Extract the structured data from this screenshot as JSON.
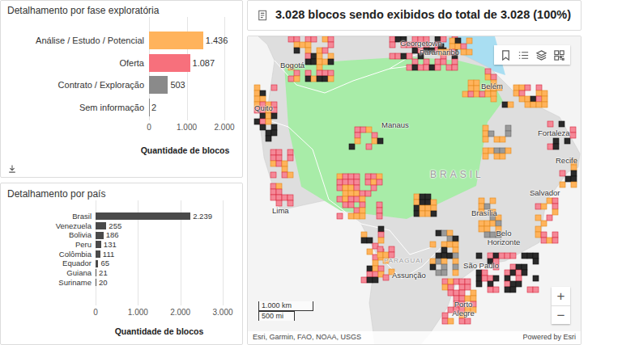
{
  "phase_chart": {
    "title": "Detalhamento por fase exploratória",
    "bars": [
      {
        "label": "Análise / Estudo / Potencial",
        "value": 1436,
        "value_label": "1.436",
        "color": "#ffb35c"
      },
      {
        "label": "Oferta",
        "value": 1087,
        "value_label": "1.087",
        "color": "#f7707c"
      },
      {
        "label": "Contrato / Exploração",
        "value": 503,
        "value_label": "503",
        "color": "#8a8a8a"
      },
      {
        "label": "Sem informação",
        "value": 2,
        "value_label": "2",
        "color": "#8a8a8a"
      }
    ],
    "ticks": [
      "0",
      "1.000",
      "2.000"
    ],
    "axis_max": 2000,
    "axis_title": "Quantidade de blocos"
  },
  "country_chart": {
    "title": "Detalhamento por país",
    "bars": [
      {
        "label": "Brasil",
        "value": 2239,
        "value_label": "2.239"
      },
      {
        "label": "Venezuela",
        "value": 255,
        "value_label": "255"
      },
      {
        "label": "Bolivia",
        "value": 186,
        "value_label": "186"
      },
      {
        "label": "Peru",
        "value": 131,
        "value_label": "131"
      },
      {
        "label": "Colômbia",
        "value": 111,
        "value_label": "111"
      },
      {
        "label": "Equador",
        "value": 65,
        "value_label": "65"
      },
      {
        "label": "Guiana",
        "value": 21,
        "value_label": "21"
      },
      {
        "label": "Suriname",
        "value": 20,
        "value_label": "20"
      }
    ],
    "ticks": [
      "0",
      "1.000",
      "2.000",
      "3.000"
    ],
    "axis_max": 3000,
    "axis_title": "Quantidade de blocos"
  },
  "summary": {
    "text": "3.028 blocos sendo exibidos do total de 3.028 (100%)"
  },
  "map": {
    "labels": [
      {
        "text": "Georgetown",
        "kind": "city"
      },
      {
        "text": "Paramaribo",
        "kind": "city"
      },
      {
        "text": "Bogotá",
        "kind": "city"
      },
      {
        "text": "Quito",
        "kind": "city"
      },
      {
        "text": "Manaus",
        "kind": "city"
      },
      {
        "text": "Belém",
        "kind": "city"
      },
      {
        "text": "Fortaleza",
        "kind": "city"
      },
      {
        "text": "Recife",
        "kind": "city"
      },
      {
        "text": "Lima",
        "kind": "city"
      },
      {
        "text": "BRASIL",
        "kind": "country"
      },
      {
        "text": "Salvador",
        "kind": "city"
      },
      {
        "text": "Brasília",
        "kind": "city"
      },
      {
        "text": "Belo Horizonte",
        "kind": "city"
      },
      {
        "text": "PARAGUAI",
        "kind": "country"
      },
      {
        "text": "Assunção",
        "kind": "city"
      },
      {
        "text": "São Paulo",
        "kind": "city"
      },
      {
        "text": "Porto Alegre",
        "kind": "city"
      }
    ],
    "zoom_in": "+",
    "zoom_out": "−",
    "scale": [
      "1.000 km",
      "500 mi"
    ],
    "attribution": "Esri, Garmin, FAO, NOAA, USGS",
    "powered_by": "Powered by Esri"
  }
}
